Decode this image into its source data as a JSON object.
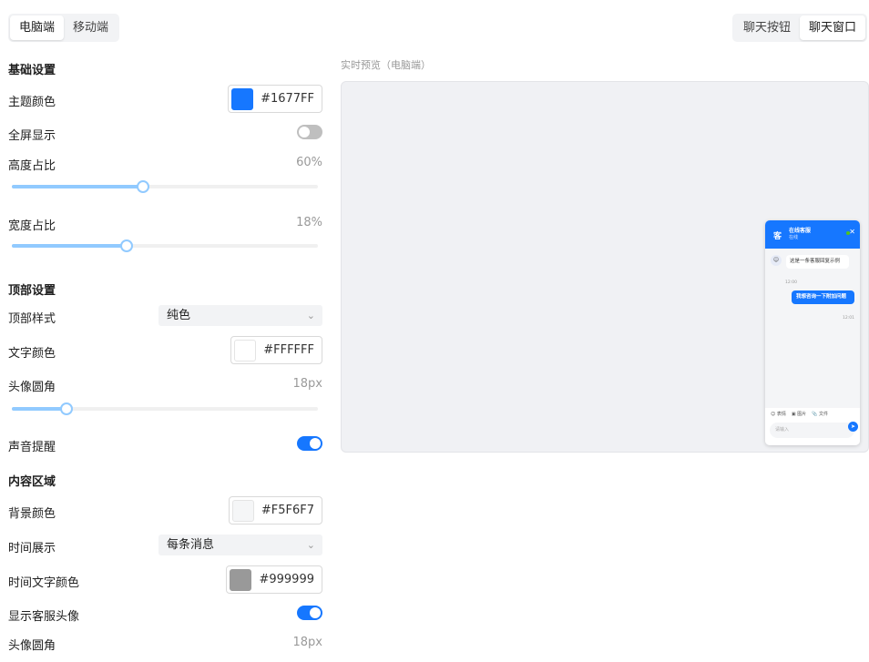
{
  "device_tabs": [
    {
      "label": "电脑端",
      "active": true
    },
    {
      "label": "移动端",
      "active": false
    }
  ],
  "view_tabs": [
    {
      "label": "聊天按钮",
      "active": false
    },
    {
      "label": "聊天窗口",
      "active": true
    }
  ],
  "basic": {
    "title": "基础设置",
    "theme_color_label": "主题颜色",
    "theme_color": "#1677FF",
    "fullscreen_label": "全屏显示",
    "fullscreen_on": false,
    "height_label": "高度占比",
    "height_value": "60%",
    "height_fraction": 0.43,
    "width_label": "宽度占比",
    "width_value": "18%",
    "width_fraction": 0.375
  },
  "header": {
    "title": "顶部设置",
    "style_label": "顶部样式",
    "style_value": "纯色",
    "text_color_label": "文字颜色",
    "text_color": "#FFFFFF",
    "avatar_radius_label": "头像圆角",
    "avatar_radius_value": "18px",
    "avatar_radius_fraction": 0.18,
    "sound_label": "声音提醒",
    "sound_on": true
  },
  "content": {
    "title": "内容区域",
    "bg_color_label": "背景颜色",
    "bg_color": "#F5F6F7",
    "time_display_label": "时间展示",
    "time_display_value": "每条消息",
    "time_text_color_label": "时间文字颜色",
    "time_text_color": "#999999",
    "show_avatar_label": "显示客服头像",
    "show_avatar_on": true,
    "avatar_radius_label": "头像圆角",
    "avatar_radius_value": "18px"
  },
  "preview": {
    "label": "实时预览（电脑端）",
    "chat": {
      "header_title": "在线客服",
      "header_status": "在线",
      "avatar_text": "客",
      "incoming_message": "这是一条客服回复示例",
      "incoming_time": "12:00",
      "outgoing_message": "我想咨询一下附加问题",
      "outgoing_time": "12:01",
      "tools": [
        "表情",
        "图片",
        "文件"
      ],
      "input_placeholder": "请输入"
    }
  },
  "colors": {
    "accent": "#1677ff",
    "slider_track": "#91caff"
  }
}
